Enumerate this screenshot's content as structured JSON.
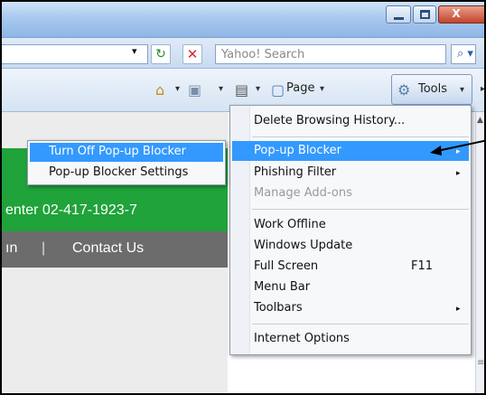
{
  "window": {
    "min_glyph": "",
    "close_glyph": "X"
  },
  "address_bar": {
    "dropdown_glyph": "▾",
    "refresh_glyph": "↻",
    "stop_glyph": "✕",
    "search_placeholder": "Yahoo! Search",
    "search_glyph": "⌕ ▾"
  },
  "command_bar": {
    "home_glyph": "⌂",
    "feeds_glyph": "▣",
    "print_glyph": "▤",
    "page_glyph": "▢",
    "page_label": "Page",
    "tools_glyph": "⚙",
    "tools_label": "Tools",
    "dropdown": "▾",
    "more": "▸"
  },
  "page_content": {
    "green_text": "enter 02-417-1923-7",
    "gray_left_text": "ın",
    "gray_sep": "|",
    "contact_us": "Contact Us"
  },
  "tools_menu": {
    "items": [
      {
        "label": "Delete Browsing History..."
      },
      {
        "label": "Pop-up Blocker"
      },
      {
        "label": "Phishing Filter"
      },
      {
        "label": "Manage Add-ons"
      },
      {
        "label": "Work Offline"
      },
      {
        "label": "Windows Update"
      },
      {
        "label": "Full Screen",
        "shortcut": "F11"
      },
      {
        "label": "Menu Bar"
      },
      {
        "label": "Toolbars"
      },
      {
        "label": "Internet Options"
      }
    ],
    "arrow": "▸"
  },
  "popup_submenu": {
    "items": [
      {
        "label": "Turn Off Pop-up Blocker"
      },
      {
        "label": "Pop-up Blocker Settings"
      }
    ]
  },
  "colors": {
    "highlight": "#3399ff",
    "green_band": "#1fa33a",
    "gray_band": "#6c6c6c"
  }
}
